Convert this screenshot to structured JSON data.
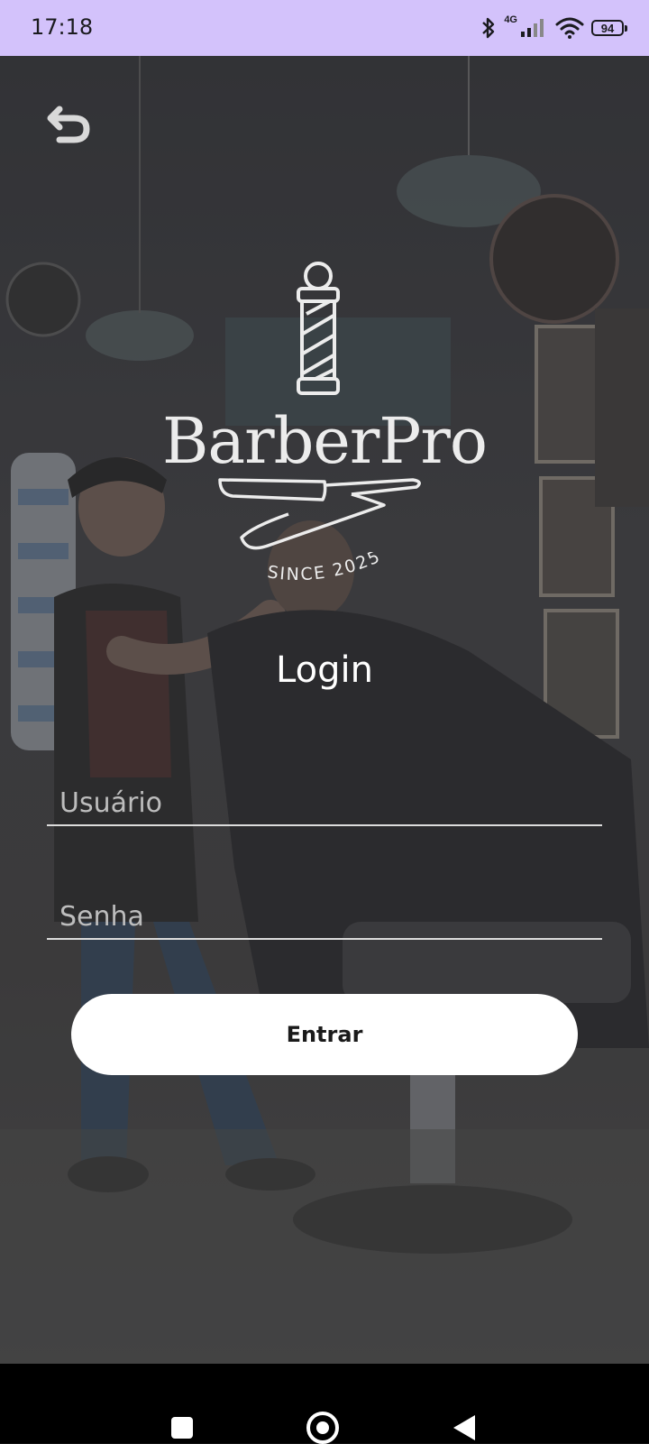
{
  "status_bar": {
    "time": "17:18",
    "network_label": "4G",
    "battery_level": "94",
    "icons": [
      "bluetooth-icon",
      "signal-icon",
      "wifi-icon",
      "battery-icon"
    ]
  },
  "app": {
    "brand_name": "BarberPro",
    "since_text": "SINCE 2025",
    "screen_title": "Login"
  },
  "form": {
    "username_placeholder": "Usuário",
    "password_placeholder": "Senha",
    "submit_label": "Entrar"
  },
  "colors": {
    "status_bar": "#d3c2fb",
    "button_bg": "#ffffff",
    "text": "#ffffff"
  },
  "navigation": {
    "icons": [
      "recents-icon",
      "home-icon",
      "back-icon"
    ]
  }
}
